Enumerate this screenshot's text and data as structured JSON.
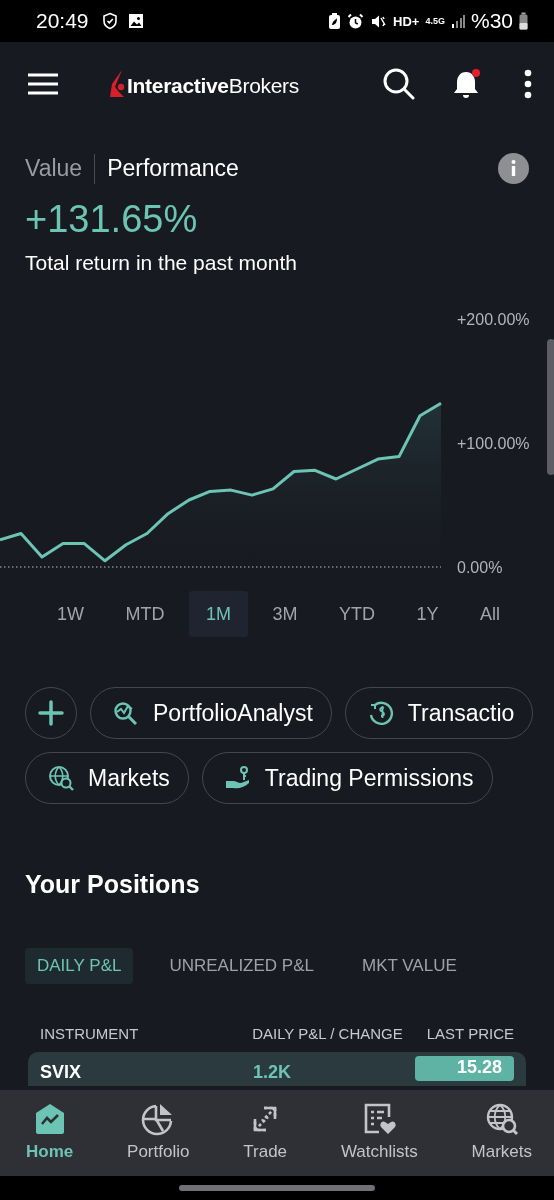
{
  "status_bar": {
    "time": "20:49",
    "network": "HD+",
    "generation": "4.5G",
    "battery": "%30"
  },
  "header": {
    "logo": "**Interactive**Brokers",
    "notification_dot": true
  },
  "view_tabs": [
    {
      "label": "Value",
      "selected": false
    },
    {
      "label": "Performance",
      "selected": true
    }
  ],
  "performance": {
    "value": "+131.65%",
    "caption": "Total return in the past month"
  },
  "chart": {
    "chart_data": {
      "type": "area",
      "ylim": [
        0,
        200
      ],
      "yticks": [
        {
          "value": 0,
          "label": "0.00%"
        },
        {
          "value": 100,
          "label": "+100.00%"
        },
        {
          "value": 200,
          "label": "+200.00%"
        }
      ],
      "series": [
        {
          "color": "#6cc4b4",
          "values": [
            22,
            27,
            8,
            19,
            19,
            5,
            18,
            27,
            43,
            54,
            61,
            62,
            58,
            63,
            77,
            78,
            71,
            79,
            87,
            89,
            122,
            132
          ]
        }
      ]
    }
  },
  "ranges": [
    {
      "label": "1W",
      "selected": false
    },
    {
      "label": "MTD",
      "selected": false
    },
    {
      "label": "1M",
      "selected": true
    },
    {
      "label": "3M",
      "selected": false
    },
    {
      "label": "YTD",
      "selected": false
    },
    {
      "label": "1Y",
      "selected": false
    },
    {
      "label": "All",
      "selected": false
    }
  ],
  "shortcut_rows": [
    [
      {
        "kind": "add"
      },
      {
        "kind": "analyst",
        "label": "PortfolioAnalyst"
      },
      {
        "kind": "transactions",
        "label": "Transactio"
      }
    ],
    [
      {
        "kind": "markets",
        "label": "Markets"
      },
      {
        "kind": "permissions",
        "label": "Trading Permissions"
      }
    ]
  ],
  "positions": {
    "title": "Your Positions",
    "tabs": [
      {
        "label": "DAILY P&L",
        "selected": true
      },
      {
        "label": "UNREALIZED P&L",
        "selected": false
      },
      {
        "label": "MKT VALUE",
        "selected": false
      }
    ],
    "columns": [
      "INSTRUMENT",
      "DAILY P&L / CHANGE",
      "LAST PRICE"
    ],
    "rows": [
      {
        "instrument": "SVIX",
        "daily_pnl": "1.2K",
        "last_price": "15.28"
      }
    ]
  },
  "nav": [
    {
      "kind": "home",
      "label": "Home",
      "selected": true
    },
    {
      "kind": "portfolio",
      "label": "Portfolio",
      "selected": false
    },
    {
      "kind": "trade",
      "label": "Trade",
      "selected": false
    },
    {
      "kind": "watchlists",
      "label": "Watchlists",
      "selected": false
    },
    {
      "kind": "markets",
      "label": "Markets",
      "selected": false
    }
  ]
}
